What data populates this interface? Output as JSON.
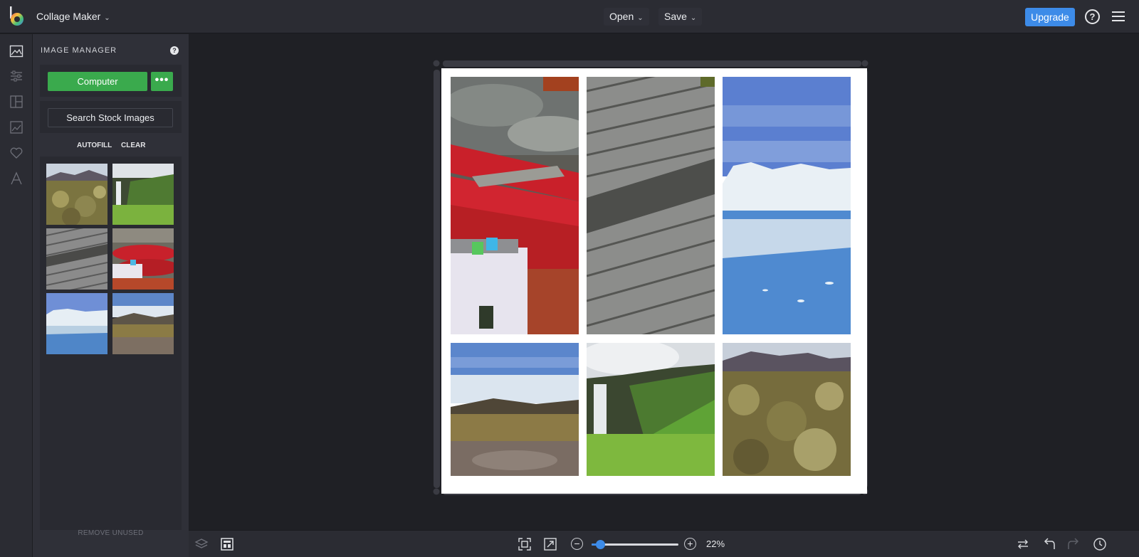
{
  "header": {
    "app_title": "Collage Maker",
    "open_label": "Open",
    "save_label": "Save",
    "upgrade_label": "Upgrade",
    "accent_color": "#3d8be8"
  },
  "rail": {
    "items": [
      "image-manager-icon",
      "adjust-icon",
      "layout-icon",
      "background-icon",
      "favorites-icon",
      "text-icon"
    ]
  },
  "panel": {
    "title": "IMAGE MANAGER",
    "computer_label": "Computer",
    "more_label": "•••",
    "stock_label": "Search Stock Images",
    "autofill_label": "AUTOFILL",
    "clear_label": "CLEAR",
    "remove_unused_label": "REMOVE UNUSED",
    "thumbnails": [
      "moss-field",
      "waterfall",
      "boardwalk",
      "red-boat",
      "icebergs",
      "tundra"
    ],
    "button_color": "#3aaa4d"
  },
  "collage": {
    "cells": [
      "red-boat",
      "boardwalk",
      "glacier",
      "tundra",
      "waterfall",
      "moss-field"
    ]
  },
  "zoom": {
    "level_label": "22%",
    "level": 0.1
  }
}
